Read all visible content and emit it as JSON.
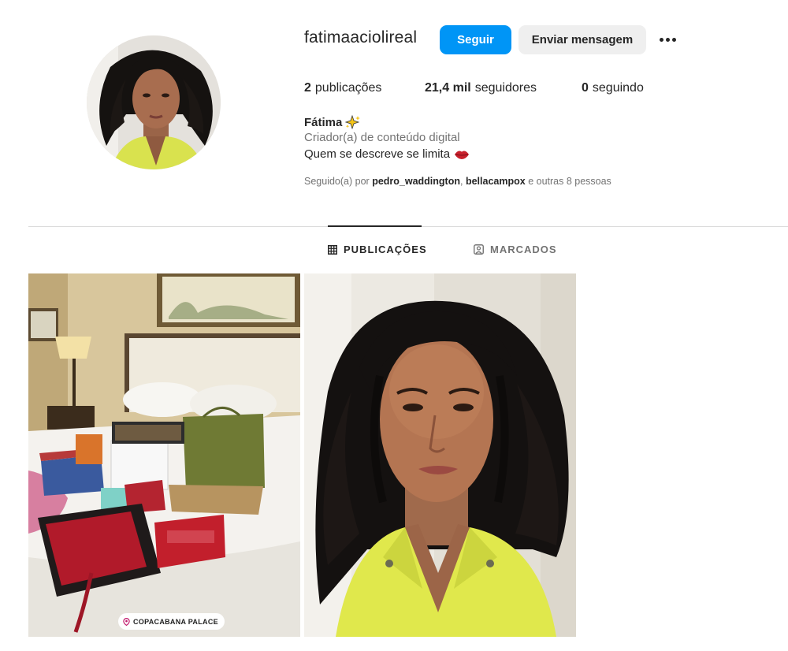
{
  "profile": {
    "username": "fatimaaciolireal",
    "full_name": "Fátima",
    "name_emoji": "sparkle",
    "category": "Criador(a) de conteúdo digital",
    "bio": "Quem se descreve se limita",
    "bio_emoji": "lips"
  },
  "actions": {
    "follow_label": "Seguir",
    "message_label": "Enviar mensagem",
    "more_icon": "more-options-icon"
  },
  "stats": {
    "posts_count": "2",
    "posts_label": "publicações",
    "followers_count": "21,4 mil",
    "followers_label": "seguidores",
    "following_count": "0",
    "following_label": "seguindo"
  },
  "followed_by": {
    "prefix": "Seguido(a) por",
    "user1": "pedro_waddington",
    "separator": ",",
    "user2": "bellacampox",
    "suffix": "e outras 8 pessoas"
  },
  "tabs": [
    {
      "label": "PUBLICAÇÕES",
      "icon": "grid-icon",
      "active": true
    },
    {
      "label": "MARCADOS",
      "icon": "tagged-icon",
      "active": false
    }
  ],
  "posts": [
    {
      "description": "hotel room bed covered with shopping bags and gift boxes",
      "location_label": "COPACABANA PALACE"
    },
    {
      "description": "selfie of woman with curly hair in yellow jacket"
    }
  ],
  "colors": {
    "accent": "#0095f6",
    "secondary_button": "#efefef",
    "text_primary": "#262626",
    "text_secondary": "#737373",
    "divider": "#dbdbdb"
  }
}
